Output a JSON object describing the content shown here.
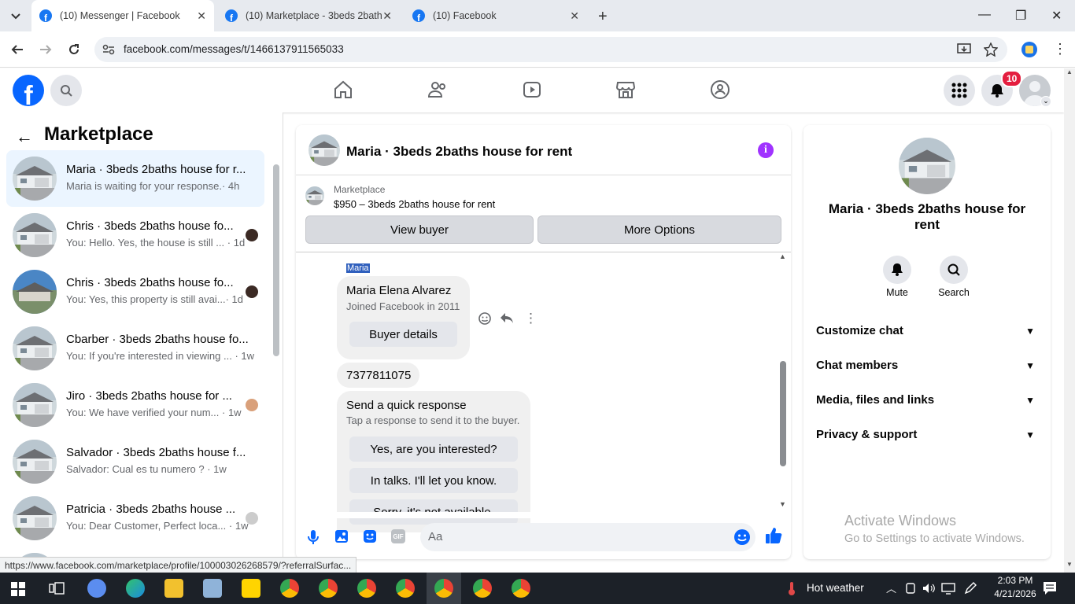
{
  "browser": {
    "tabs": [
      {
        "title": "(10) Messenger | Facebook",
        "active": true
      },
      {
        "title": "(10) Marketplace - 3beds 2bath",
        "active": false
      },
      {
        "title": "(10) Facebook",
        "active": false
      }
    ],
    "url": "facebook.com/messages/t/1466137911565033",
    "status_url": "https://www.facebook.com/marketplace/profile/100003026268579/?referralSurfac..."
  },
  "header": {
    "notifications_count": "10"
  },
  "sidebar": {
    "title": "Marketplace",
    "conversations": [
      {
        "name": "Maria · 3beds 2baths house for r...",
        "preview": "Maria is waiting for your response.",
        "time": "· 4h",
        "selected": true
      },
      {
        "name": "Chris · 3beds 2baths house fo...",
        "preview": "You: Hello. Yes, the house is still ...",
        "time": "· 1d"
      },
      {
        "name": "Chris · 3beds 2baths house fo...",
        "preview": "You: Yes, this property is still avai...",
        "time": "· 1d"
      },
      {
        "name": "Cbarber · 3beds 2baths house fo...",
        "preview": "You: If you're interested in viewing ...",
        "time": "· 1w"
      },
      {
        "name": "Jiro · 3beds 2baths house for ...",
        "preview": "You: We have verified your num...",
        "time": "· 1w"
      },
      {
        "name": "Salvador · 3beds 2baths house f...",
        "preview": "Salvador: Cual es tu numero ?",
        "time": "· 1w"
      },
      {
        "name": "Patricia · 3beds 2baths house ...",
        "preview": "You: Dear Customer, Perfect loca...",
        "time": "· 1w"
      }
    ]
  },
  "chat": {
    "title": "Maria · 3beds 2baths house for rent",
    "marketplace_label": "Marketplace",
    "listing": "$950 – 3beds 2baths house for rent",
    "view_buyer": "View buyer",
    "more_options": "More Options",
    "sender_label": "Maria",
    "profile_name": "Maria Elena Alvarez",
    "profile_joined": "Joined Facebook in 2011",
    "buyer_details": "Buyer details",
    "phone_message": "7377811075",
    "quick_title": "Send a quick response",
    "quick_subtitle": "Tap a response to send it to the buyer.",
    "quick_replies": [
      "Yes, are you interested?",
      "In talks. I'll let you know.",
      "Sorry, it's not available."
    ],
    "composer_placeholder": "Aa"
  },
  "details": {
    "name": "Maria · 3beds 2baths house for rent",
    "mute": "Mute",
    "search": "Search",
    "sections": [
      "Customize chat",
      "Chat members",
      "Media, files and links",
      "Privacy & support"
    ]
  },
  "watermark": {
    "line1": "Activate Windows",
    "line2": "Go to Settings to activate Windows."
  },
  "taskbar": {
    "weather": "Hot weather",
    "time": "2:03 PM",
    "date": "4/21/2026"
  },
  "colors": {
    "fb_blue": "#0866ff",
    "messenger_purple": "#a033ff",
    "selected_row": "#ebf5ff"
  }
}
